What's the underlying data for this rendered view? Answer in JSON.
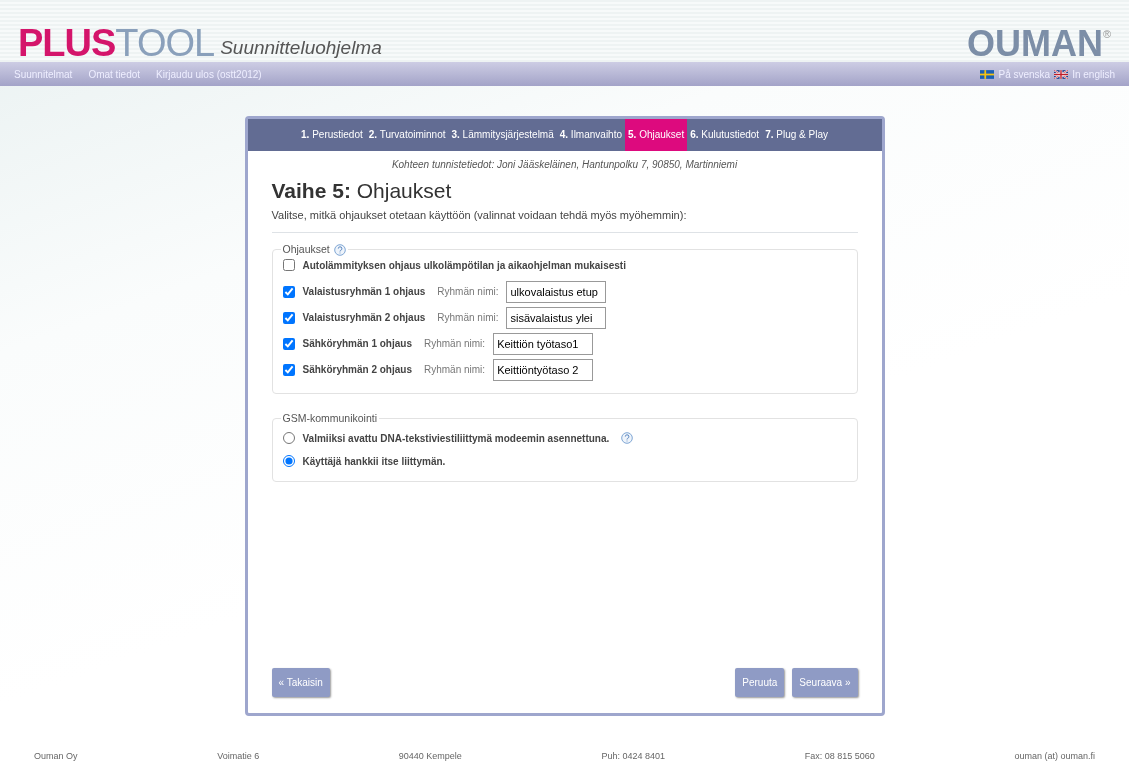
{
  "header": {
    "logo_part_1": "PLUS",
    "logo_part_2": "TOOL",
    "subtitle": "Suunnitteluohjelma",
    "brand": "OUMAN",
    "brand_mark": "®"
  },
  "nav": {
    "links": [
      "Suunnitelmat",
      "Omat tiedot",
      "Kirjaudu ulos (ostt2012)"
    ],
    "languages": [
      {
        "label": "På svenska",
        "kind": "sweden"
      },
      {
        "label": "In english",
        "kind": "britain"
      }
    ]
  },
  "steps": [
    {
      "label": "**1.** Perustiedot",
      "selected": false
    },
    {
      "label": "**2.** Turvatoiminnot",
      "selected": false
    },
    {
      "label": "**3.** Lämmitysjärjestelmä",
      "selected": false
    },
    {
      "label": "**4.** Ilmanvaihto",
      "selected": false
    },
    {
      "label": "**5.** Ohjaukset",
      "selected": true
    },
    {
      "label": "**6.** Kulutustiedot",
      "selected": false
    },
    {
      "label": "**7.** Plug & Play",
      "selected": false
    }
  ],
  "site_info": "Kohteen tunnistetiedot: Joni Jääskeläinen, Hantunpolku 7, 90850, Martinniemi",
  "heading": "**Vaihe 5:** Ohjaukset",
  "intro": "Valitse, mitkä ohjaukset otetaan käyttöön (valinnat voidaan tehdä myös myöhemmin):",
  "controls": {
    "legend": "Ohjaukset",
    "items": [
      {
        "label": "Autolämmityksen ohjaus ulkolämpötilan ja aikaohjelman mukaisesti",
        "checked": false
      },
      {
        "label": "Valaistusryhmän 1 ohjaus",
        "checked": true,
        "name_label": "Ryhmän nimi:",
        "value": "ulkovalaistus etup"
      },
      {
        "label": "Valaistusryhmän 2 ohjaus",
        "checked": true,
        "name_label": "Ryhmän nimi:",
        "value": "sisävalaistus ylei"
      },
      {
        "label": "Sähköryhmän 1 ohjaus",
        "checked": true,
        "name_label": "Ryhmän nimi:",
        "value": "Keittiön työtaso1"
      },
      {
        "label": "Sähköryhmän 2 ohjaus",
        "checked": true,
        "name_label": "Ryhmän nimi:",
        "value": "Keittiöntyötaso 2"
      }
    ]
  },
  "gsm": {
    "legend": "GSM-kommunikointi",
    "options": [
      {
        "label": "Valmiiksi avattu DNA-tekstiviestiliittymä modeemin asennettuna.",
        "selected": false,
        "help": true
      },
      {
        "label": "Käyttäjä hankkii itse liittymän.",
        "selected": true,
        "help": false
      }
    ]
  },
  "buttons": {
    "back": "« Takaisin",
    "cancel": "Peruuta",
    "next": "Seuraava »"
  },
  "footer": [
    "Ouman Oy",
    "Voimatie 6",
    "90440 Kempele",
    "Puh: 0424 8401",
    "Fax: 08 815 5060",
    "ouman (at) ouman.fi"
  ]
}
